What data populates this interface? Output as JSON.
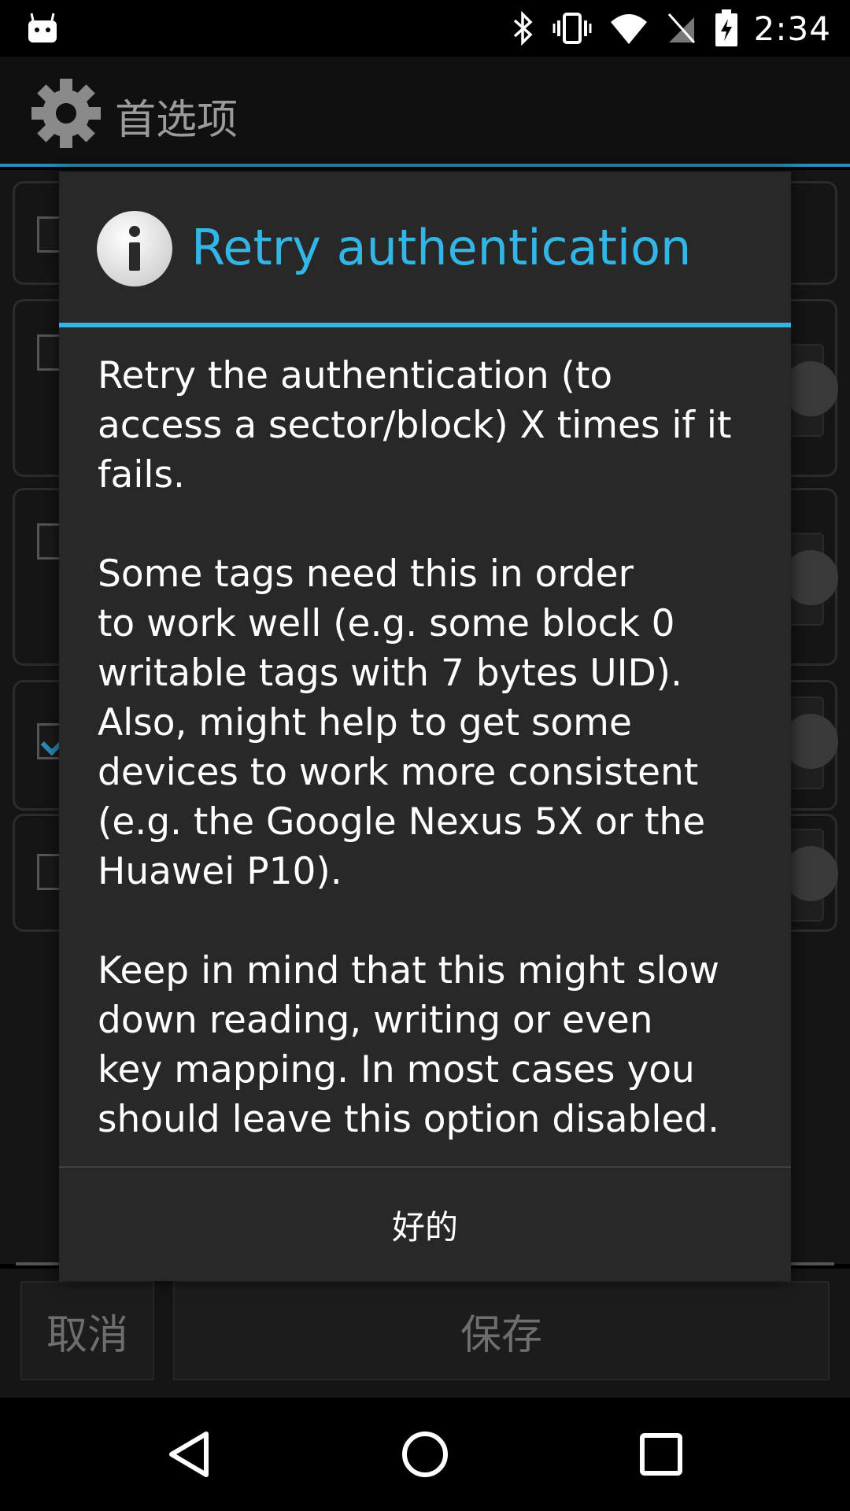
{
  "status_bar": {
    "time": "2:34",
    "icons": [
      "android-notification-icon",
      "bluetooth-icon",
      "vibrate-icon",
      "wifi-icon",
      "no-sim-icon",
      "battery-charging-icon"
    ]
  },
  "action_bar": {
    "title": "首选项",
    "icon": "gear-icon"
  },
  "bottom_buttons": {
    "cancel_label": "取消",
    "save_label": "保存"
  },
  "dialog": {
    "icon": "info-icon",
    "title": "Retry authentication",
    "message": "Retry the authentication (to\naccess a sector/block) X times if it\nfails.\n\nSome tags need this in order\nto work well (e.g. some block 0\nwritable tags with 7 bytes UID).\nAlso, might help to get some\ndevices to work more consistent\n(e.g. the Google Nexus 5X or the\nHuawei P10).\n\nKeep in mind that this might slow\ndown reading, writing or even\nkey mapping. In most cases you\nshould leave this option disabled.",
    "ok_label": "好的"
  },
  "nav_bar": {
    "icons": [
      "back-icon",
      "home-icon",
      "recents-icon"
    ]
  },
  "colors": {
    "accent": "#33b5e5",
    "dialog_bg": "#282828",
    "background": "#000000"
  }
}
